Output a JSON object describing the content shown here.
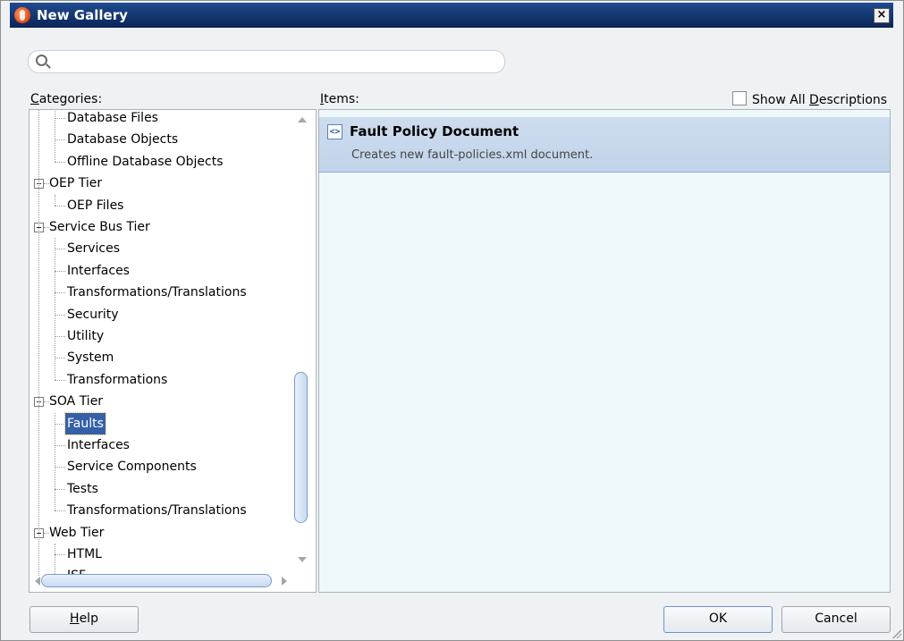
{
  "window": {
    "title": "New Gallery",
    "close_label": "×"
  },
  "search": {
    "value": "",
    "placeholder": ""
  },
  "categories": {
    "label_prefix": "",
    "label_mnemonic": "C",
    "label_rest": "ategories:",
    "tree": [
      {
        "label": "Database Files",
        "level": 1
      },
      {
        "label": "Database Objects",
        "level": 1
      },
      {
        "label": "Offline Database Objects",
        "level": 1
      },
      {
        "label": "OEP Tier",
        "level": 0
      },
      {
        "label": "OEP Files",
        "level": 1
      },
      {
        "label": "Service Bus Tier",
        "level": 0
      },
      {
        "label": "Services",
        "level": 1
      },
      {
        "label": "Interfaces",
        "level": 1
      },
      {
        "label": "Transformations/Translations",
        "level": 1
      },
      {
        "label": "Security",
        "level": 1
      },
      {
        "label": "Utility",
        "level": 1
      },
      {
        "label": "System",
        "level": 1
      },
      {
        "label": "Transformations",
        "level": 1
      },
      {
        "label": "SOA Tier",
        "level": 0
      },
      {
        "label": "Faults",
        "level": 1,
        "selected": true
      },
      {
        "label": "Interfaces",
        "level": 1
      },
      {
        "label": "Service Components",
        "level": 1
      },
      {
        "label": "Tests",
        "level": 1
      },
      {
        "label": "Transformations/Translations",
        "level": 1
      },
      {
        "label": "Web Tier",
        "level": 0
      },
      {
        "label": "HTML",
        "level": 1
      },
      {
        "label": "JSF",
        "level": 1
      }
    ]
  },
  "items": {
    "label_mnemonic": "I",
    "label_rest": "tems:",
    "show_all_prefix": "Show All ",
    "show_all_mnemonic": "D",
    "show_all_rest": "escriptions",
    "entries": [
      {
        "title": "Fault Policy Document",
        "description": "Creates new fault-policies.xml document.",
        "icon": "xml-document-icon"
      }
    ]
  },
  "buttons": {
    "help_mnemonic": "H",
    "help_rest": "elp",
    "ok": "OK",
    "cancel": "Cancel"
  },
  "colors": {
    "titlebar": "#0f2e63",
    "selection": "#3560a8",
    "item_highlight": "#c6d7ec"
  }
}
